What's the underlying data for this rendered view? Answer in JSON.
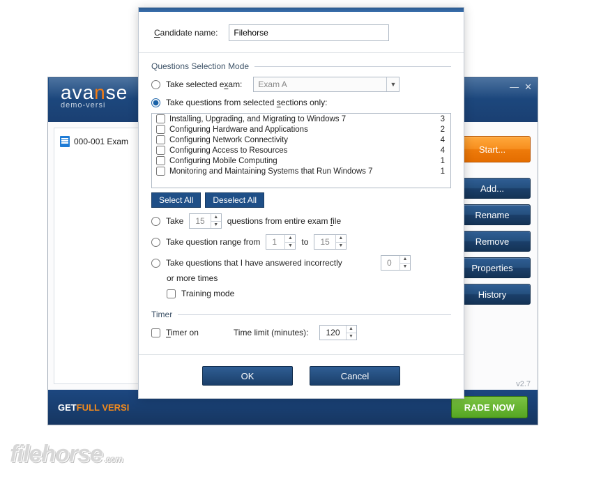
{
  "mainWindow": {
    "logo1_pre": "ava",
    "logo1_accent": "n",
    "logo1_post": "se",
    "logo2": "demo-versi",
    "examItem": "000-001 Exam",
    "buttons": {
      "start": "Start...",
      "add": "Add...",
      "rename": "Rename",
      "remove": "Remove",
      "properties": "Properties",
      "history": "History"
    },
    "version": "v2.7",
    "footer_pre": "GET ",
    "footer_hi": "FULL VERSI",
    "upgrade": "RADE NOW"
  },
  "dialog": {
    "candLabel_pre": "C",
    "candLabel_rest": "andidate name:",
    "candValue": "Filehorse",
    "qsmTitle": "Questions Selection Mode",
    "opt1_pre": "Take selected e",
    "opt1_u": "x",
    "opt1_post": "am:",
    "opt1_combo": "Exam A",
    "opt2_pre": "Take questions from selected ",
    "opt2_u": "s",
    "opt2_post": "ections only:",
    "sections": [
      {
        "label": "Installing, Upgrading, and Migrating to Windows 7",
        "count": 3
      },
      {
        "label": "Configuring Hardware and Applications",
        "count": 2
      },
      {
        "label": "Configuring Network Connectivity",
        "count": 4
      },
      {
        "label": "Configuring Access to Resources",
        "count": 4
      },
      {
        "label": "Configuring Mobile Computing",
        "count": 1
      },
      {
        "label": "Monitoring and Maintaining Systems that Run Windows 7",
        "count": 1
      }
    ],
    "selectAll": "Select All",
    "deselectAll": "Deselect All",
    "opt3_take": "Take",
    "opt3_count": "15",
    "opt3_rest_pre": "questions from entire exam ",
    "opt3_rest_u": "f",
    "opt3_rest_post": "ile",
    "opt4_pre": "Take question range from",
    "opt4_from": "1",
    "opt4_to_lbl": "to",
    "opt4_to": "15",
    "opt5": "Take questions that I have answered incorrectly",
    "opt5_val": "0",
    "opt5_line2": "or more times",
    "training": "Training mode",
    "timerTitle": "Timer",
    "timerOn_u": "T",
    "timerOn_rest": "imer on",
    "timeLimitLabel": "Time limit (minutes):",
    "timeLimitVal": "120",
    "ok": "OK",
    "cancel": "Cancel"
  },
  "watermark": {
    "main": "filehorse",
    "suffix": ".com"
  }
}
